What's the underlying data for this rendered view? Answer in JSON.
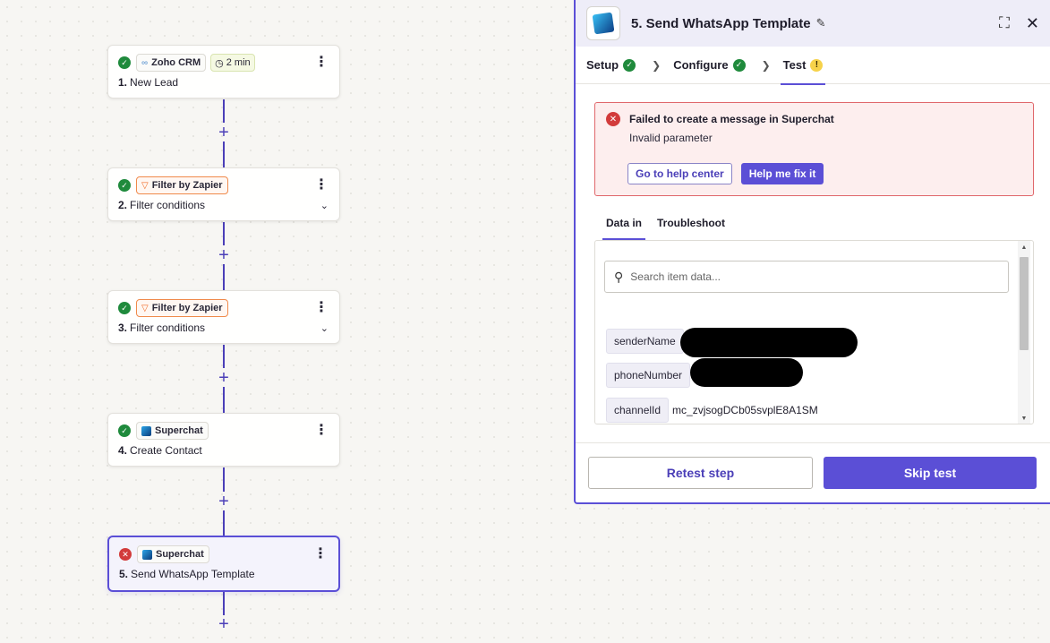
{
  "workflow": {
    "steps": [
      {
        "number": "1.",
        "name": "New Lead",
        "app": "Zoho CRM",
        "time_badge": "2 min",
        "status": "success",
        "has_chevron": false
      },
      {
        "number": "2.",
        "name": "Filter conditions",
        "app": "Filter by Zapier",
        "status": "success",
        "has_chevron": true
      },
      {
        "number": "3.",
        "name": "Filter conditions",
        "app": "Filter by Zapier",
        "status": "success",
        "has_chevron": true
      },
      {
        "number": "4.",
        "name": "Create Contact",
        "app": "Superchat",
        "status": "success",
        "has_chevron": false
      },
      {
        "number": "5.",
        "name": "Send WhatsApp Template",
        "app": "Superchat",
        "status": "error",
        "has_chevron": false
      }
    ],
    "add_symbol": "+"
  },
  "panel": {
    "title": "5. Send WhatsApp Template",
    "tabs": [
      {
        "label": "Setup",
        "status": "complete"
      },
      {
        "label": "Configure",
        "status": "complete"
      },
      {
        "label": "Test",
        "status": "warning"
      }
    ],
    "error": {
      "title": "Failed to create a message in Superchat",
      "message": "Invalid parameter",
      "help_button": "Go to help center",
      "fix_button": "Help me fix it"
    },
    "subtabs": [
      "Data in",
      "Troubleshoot"
    ],
    "search": {
      "placeholder": "Search item data..."
    },
    "data_items": [
      {
        "key": "senderName",
        "value": "",
        "redacted": true
      },
      {
        "key": "phoneNumber",
        "value": "",
        "redacted": true
      },
      {
        "key": "channelId",
        "value": "mc_zvjsogDCb05svplE8A1SM",
        "redacted": false
      }
    ],
    "footer": {
      "retest_label": "Retest step",
      "skip_label": "Skip test"
    }
  },
  "colors": {
    "accent": "#5b4fd6",
    "success": "#1f8a3c",
    "error": "#d23b3b",
    "warning": "#f6d24a",
    "filter": "#f06a25"
  }
}
